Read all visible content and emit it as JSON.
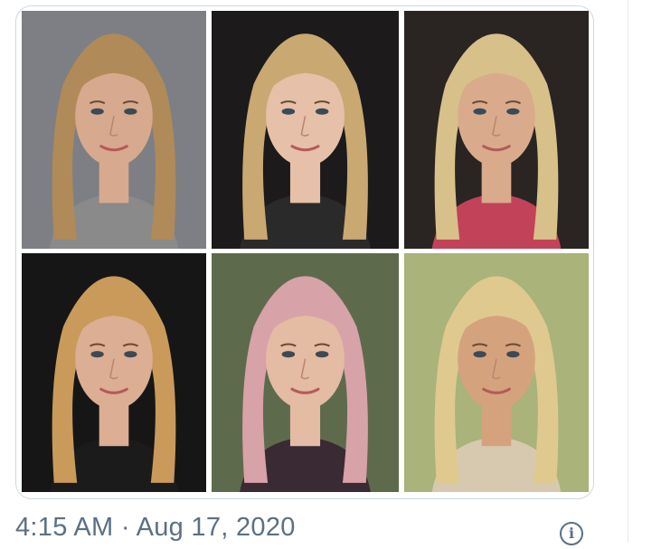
{
  "tweet": {
    "timestamp": "4:15 AM · Aug 17, 2020",
    "info_icon": "info-icon"
  },
  "media": {
    "photos": [
      {
        "name": "photo-1",
        "bg": "#7d7f84",
        "hair": "#b08a58",
        "skin": "#d7a98e",
        "cloth": "#8a8a8a"
      },
      {
        "name": "photo-2",
        "bg": "#1c1a1a",
        "hair": "#c9a872",
        "skin": "#e6c0a8",
        "cloth": "#2a2a2a"
      },
      {
        "name": "photo-3",
        "bg": "#2a2522",
        "hair": "#d8c08a",
        "skin": "#d9ab8c",
        "cloth": "#c2425a"
      },
      {
        "name": "photo-4",
        "bg": "#161616",
        "hair": "#c99a5a",
        "skin": "#dcae94",
        "cloth": "#1b1b1b"
      },
      {
        "name": "photo-5",
        "bg": "#5d6b4c",
        "hair": "#d7a2a8",
        "skin": "#e4bba3",
        "cloth": "#3a2a33"
      },
      {
        "name": "photo-6",
        "bg": "#a9b37a",
        "hair": "#e0c98e",
        "skin": "#d5a27e",
        "cloth": "#d7c9b0"
      }
    ]
  }
}
